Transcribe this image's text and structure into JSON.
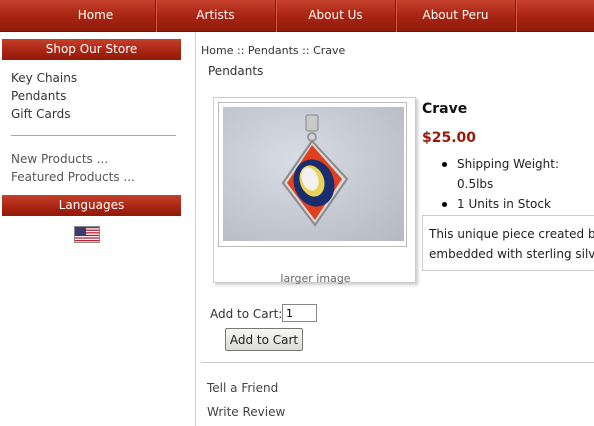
{
  "nav": {
    "items": [
      {
        "label": "Home"
      },
      {
        "label": "Artists"
      },
      {
        "label": "About Us"
      },
      {
        "label": "About Peru"
      }
    ]
  },
  "sidebar": {
    "shop_header": "Shop Our Store",
    "categories": [
      {
        "label": "Key Chains"
      },
      {
        "label": "Pendants"
      },
      {
        "label": "Gift Cards"
      }
    ],
    "extra_links": [
      {
        "label": "New Products ..."
      },
      {
        "label": "Featured Products ..."
      }
    ],
    "languages_header": "Languages",
    "language_flag": "us-flag-icon"
  },
  "breadcrumb": {
    "items": [
      "Home",
      "Pendants",
      "Crave"
    ],
    "separator": "::"
  },
  "category_title": "Pendants",
  "product": {
    "name": "Crave",
    "price": "$25.00",
    "attributes": [
      "Shipping Weight: 0.5lbs",
      "1 Units in Stock"
    ],
    "description_line1": "This unique piece created by",
    "description_line2": "embedded with sterling silver",
    "larger_image_label": "larger image",
    "image_icon": "pendant-photo"
  },
  "cart": {
    "label": "Add to Cart:",
    "quantity": "1",
    "button_label": "Add to Cart"
  },
  "footer_links": {
    "tell_friend": "Tell a Friend",
    "write_review": "Write Review"
  },
  "colors": {
    "brand_red": "#a82412",
    "price_red": "#9a1a0a"
  }
}
